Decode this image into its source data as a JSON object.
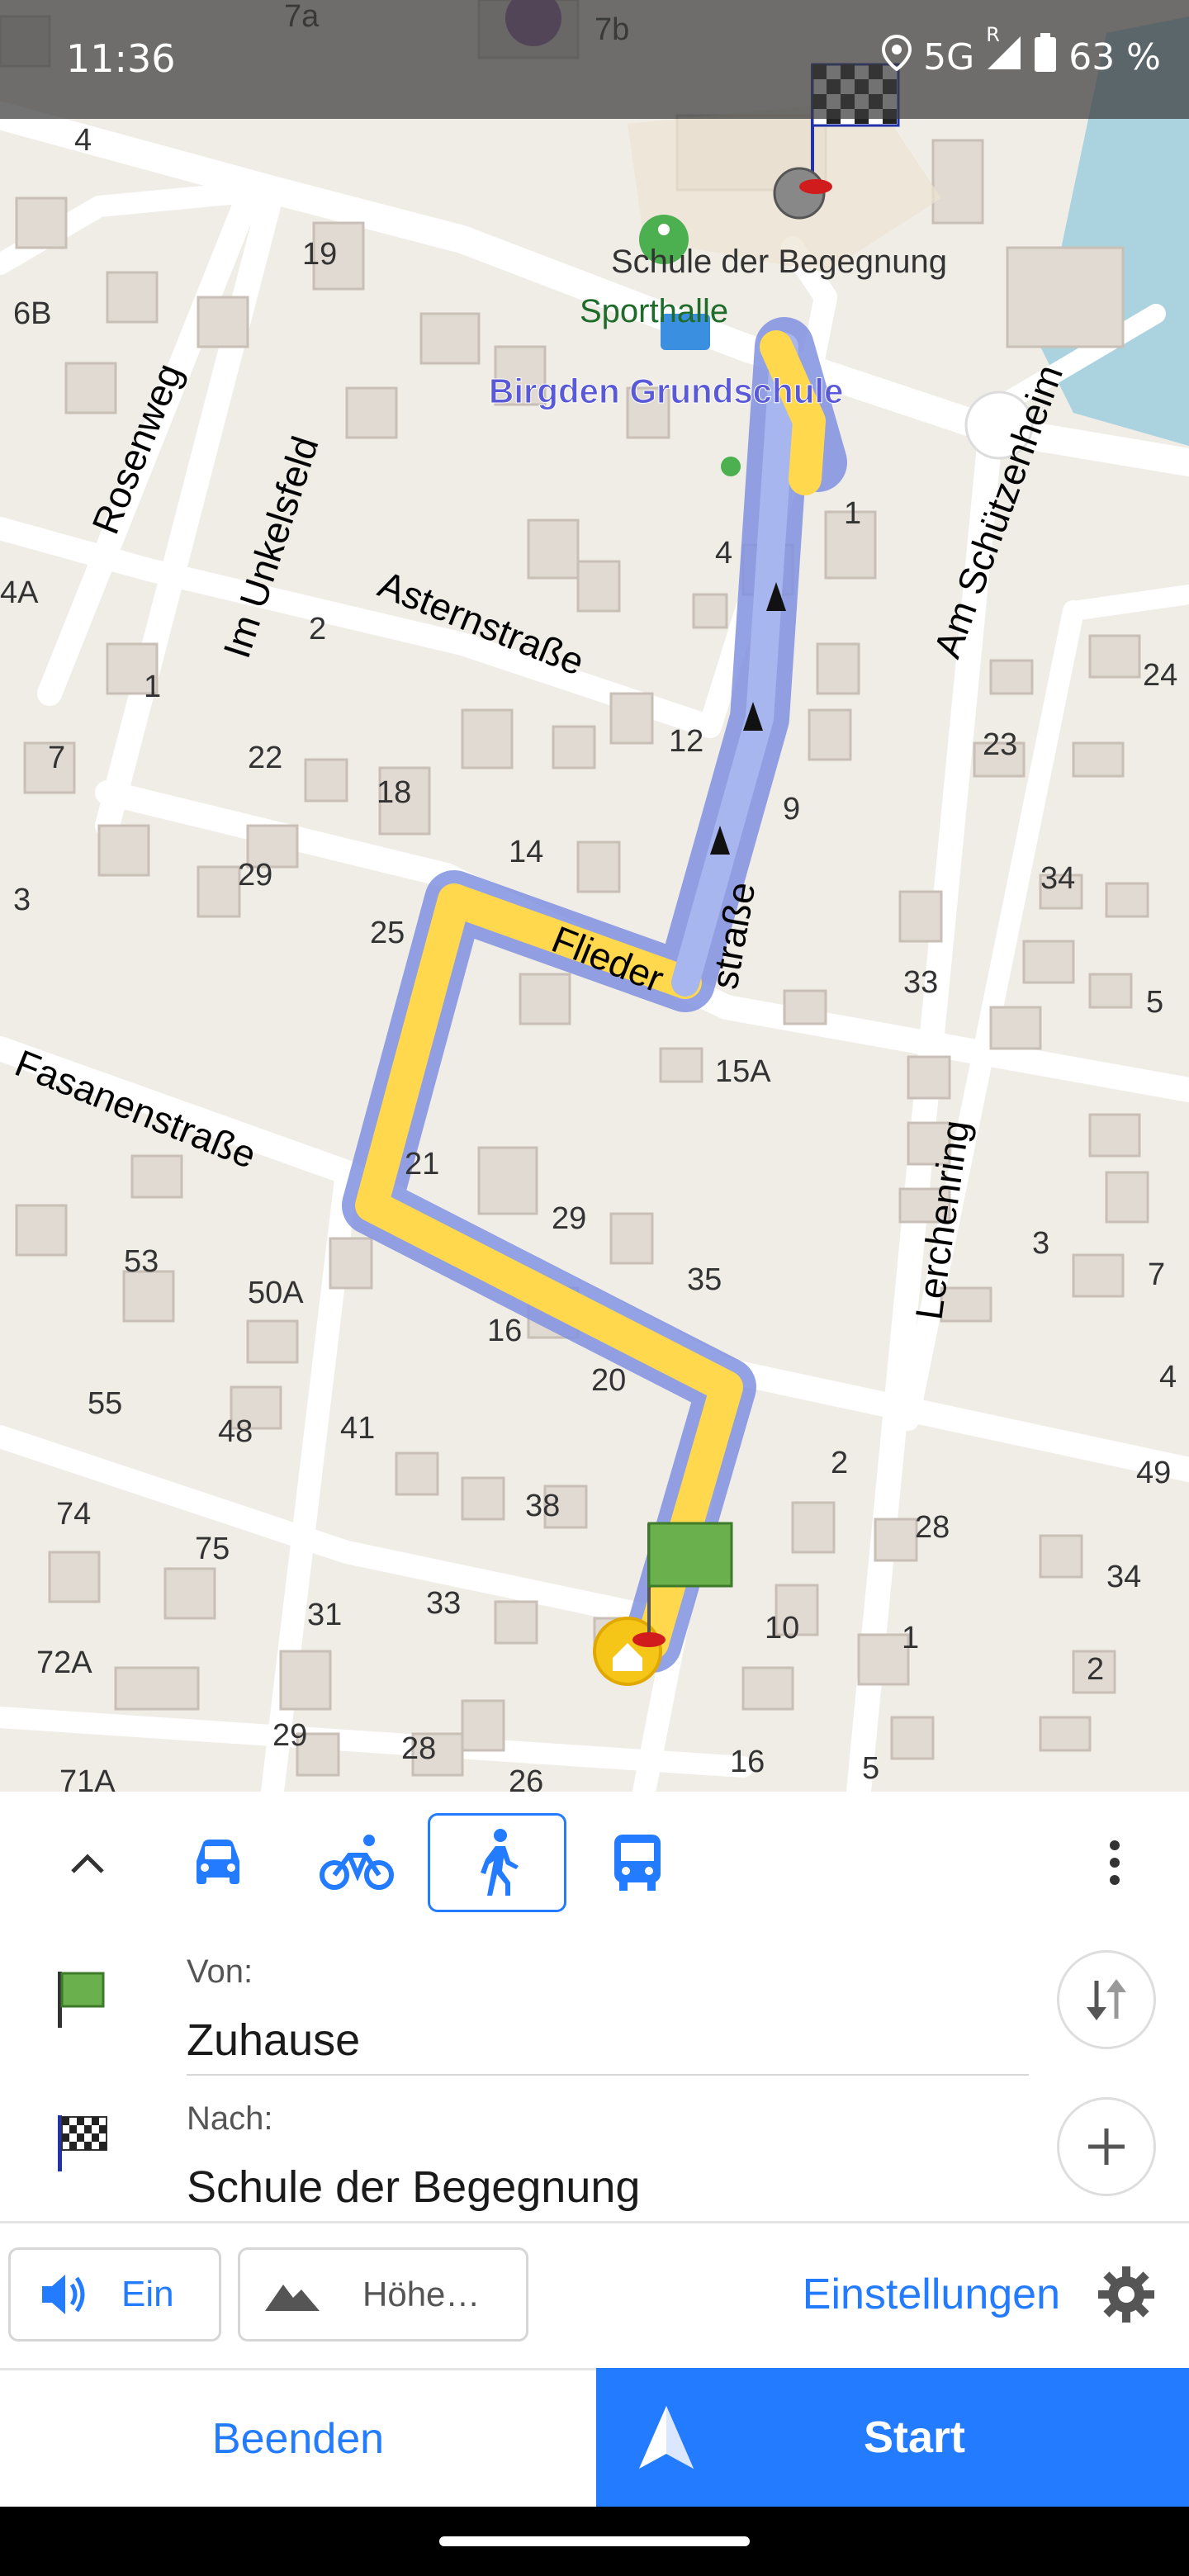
{
  "status_bar": {
    "time": "11:36",
    "network": "5G",
    "roaming": "R",
    "battery": "63 %"
  },
  "map": {
    "street_labels": [
      "Rosenweg",
      "Im Unkelsfeld",
      "Asternstraße",
      "Am Schützenheim",
      "Flieder",
      "straße",
      "Fasanenstraße",
      "Lerchenring"
    ],
    "poi_labels": [
      "Schule der Begegnung",
      "Sporthalle",
      "Birgden Grundschule"
    ],
    "house_numbers": [
      "7a",
      "7b",
      "4",
      "6B",
      "19",
      "4A",
      "2",
      "1",
      "4",
      "1",
      "24",
      "7",
      "22",
      "18",
      "12",
      "23",
      "9",
      "3",
      "29",
      "14",
      "34",
      "25",
      "33",
      "5",
      "15A",
      "21",
      "29",
      "53",
      "50A",
      "35",
      "3",
      "7",
      "16",
      "20",
      "4",
      "55",
      "48",
      "41",
      "2",
      "49",
      "74",
      "75",
      "38",
      "28",
      "34",
      "31",
      "33",
      "10",
      "1",
      "72A",
      "2",
      "29",
      "28",
      "26",
      "16",
      "5",
      "71A"
    ],
    "route_color": "#ffd84d",
    "route_outline_color": "#8090e0"
  },
  "modes": {
    "collapse_icon": "chevron-up-icon",
    "items": [
      {
        "name": "car-icon",
        "active": false
      },
      {
        "name": "bicycle-icon",
        "active": false
      },
      {
        "name": "pedestrian-icon",
        "active": true
      },
      {
        "name": "bus-icon",
        "active": false
      }
    ],
    "more_icon": "more-vertical-icon"
  },
  "from": {
    "label": "Von:",
    "value": "Zuhause",
    "icon": "green-flag-icon"
  },
  "to": {
    "label": "Nach:",
    "value": "Schule der Begegnung",
    "icon": "checkered-flag-icon"
  },
  "options": {
    "sound_label": "Ein",
    "elevation_label": "Höhe…",
    "settings_label": "Einstellungen"
  },
  "actions": {
    "cancel_label": "Beenden",
    "start_label": "Start"
  },
  "colors": {
    "accent": "#237bff",
    "start_bg": "#237bff",
    "text_dark": "#1a1a1a"
  }
}
